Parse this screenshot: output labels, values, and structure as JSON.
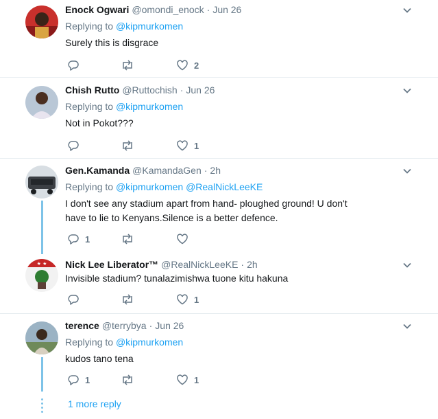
{
  "tweets": [
    {
      "name": "Enock Ogwari",
      "handle": "@omondi_enock",
      "time": "Jun 26",
      "replying_prefix": "Replying to",
      "replying_to": "@kipmurkomen",
      "replying_extra": "",
      "text": "Surely this is disgrace",
      "reply_count": "",
      "retweet_count": "",
      "like_count": "2"
    },
    {
      "name": "Chish Rutto",
      "handle": "@Ruttochish",
      "time": "Jun 26",
      "replying_prefix": "Replying to",
      "replying_to": "@kipmurkomen",
      "replying_extra": "",
      "text": "Not in Pokot???",
      "reply_count": "",
      "retweet_count": "",
      "like_count": "1"
    },
    {
      "name": "Gen.Kamanda",
      "handle": "@KamandaGen",
      "time": "2h",
      "replying_prefix": "Replying to",
      "replying_to": "@kipmurkomen",
      "replying_extra": "@RealNickLeeKE",
      "text": "I don't see any stadium apart from hand- ploughed ground! U don't have to lie to Kenyans.Silence is a better defence.",
      "reply_count": "1",
      "retweet_count": "",
      "like_count": ""
    },
    {
      "name": "Nick Lee Liberator™",
      "handle": "@RealNickLeeKE",
      "time": "2h",
      "replying_prefix": "",
      "replying_to": "",
      "replying_extra": "",
      "text": "Invisible stadium? tunalazimishwa tuone kitu hakuna",
      "reply_count": "",
      "retweet_count": "",
      "like_count": "1"
    },
    {
      "name": "terence",
      "handle": "@terrybya",
      "time": "Jun 26",
      "replying_prefix": "Replying to",
      "replying_to": "@kipmurkomen",
      "replying_extra": "",
      "text": "kudos tano tena",
      "reply_count": "1",
      "retweet_count": "",
      "like_count": "1"
    }
  ],
  "more_replies": "1 more reply",
  "colors": {
    "link": "#1da1f2",
    "muted": "#657786",
    "thread": "#7ec3e8",
    "divider": "#e6ecf0"
  }
}
